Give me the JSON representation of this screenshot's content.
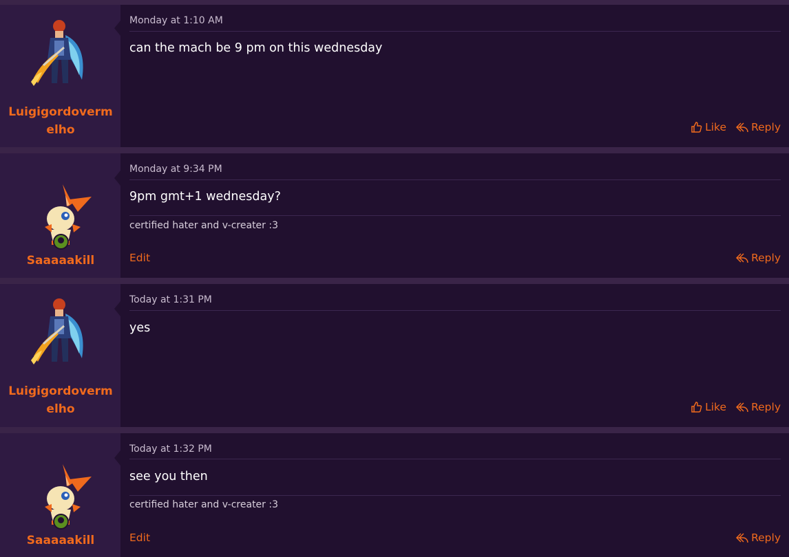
{
  "posts": [
    {
      "username": "Luigigordovermelho",
      "username_lines": [
        "Luigigordoverm",
        "elho"
      ],
      "date": "Monday at 1:10 AM",
      "body": "can the mach be 9 pm on this wednesday",
      "signature": "",
      "actions": {
        "like": "Like",
        "reply": "Reply",
        "edit": ""
      }
    },
    {
      "username": "Saaaaakill",
      "date": "Monday at 9:34 PM",
      "body": "9pm gmt+1 wednesday?",
      "signature": "certified hater and v-creater :3",
      "actions": {
        "like": "",
        "reply": "Reply",
        "edit": "Edit"
      }
    },
    {
      "username": "Luigigordovermelho",
      "username_lines": [
        "Luigigordoverm",
        "elho"
      ],
      "date": "Today at 1:31 PM",
      "body": "yes",
      "signature": "",
      "actions": {
        "like": "Like",
        "reply": "Reply",
        "edit": ""
      }
    },
    {
      "username": "Saaaaakill",
      "date": "Today at 1:32 PM",
      "body": "see you then",
      "signature": "certified hater and v-creater :3",
      "actions": {
        "like": "",
        "reply": "Reply",
        "edit": "Edit"
      }
    }
  ],
  "colors": {
    "accent": "#f06a1d",
    "post_bg": "#21102f",
    "user_bg": "#2f1a42",
    "page_bg": "#3a2448"
  },
  "icons": {
    "like": "thumbs-up-icon",
    "reply": "reply-arrow-icon",
    "online": "online-status-icon"
  }
}
